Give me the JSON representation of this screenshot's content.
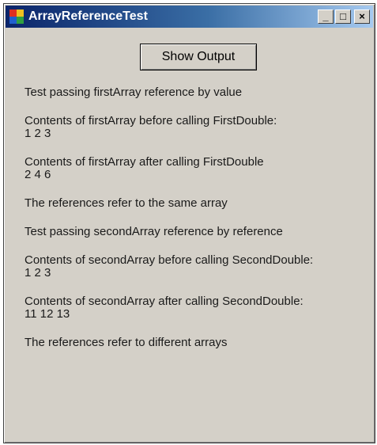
{
  "window": {
    "title": "ArrayReferenceTest",
    "minimize_glyph": "_",
    "maximize_glyph": "□",
    "close_glyph": "×"
  },
  "controls": {
    "show_output_label": "Show Output"
  },
  "output": {
    "lines": [
      "Test passing firstArray reference by value",
      "Contents of firstArray before calling FirstDouble:\n1 2 3",
      "Contents of firstArray after calling FirstDouble\n2 4 6",
      "The references refer to the same array",
      "Test passing secondArray reference by reference",
      "Contents of secondArray before calling SecondDouble:\n1 2 3",
      "Contents of secondArray after calling SecondDouble:\n11 12 13",
      "The references refer to different arrays"
    ]
  }
}
